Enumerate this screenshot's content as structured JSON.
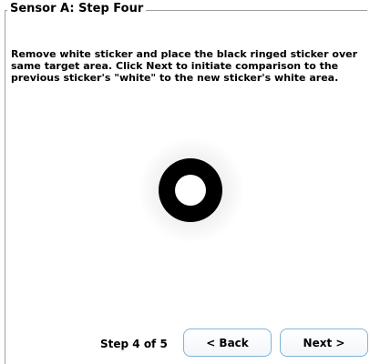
{
  "group": {
    "title": "Sensor A: Step Four"
  },
  "instructions": "Remove white sticker and place the black ringed sticker over same target area.  Click Next to initiate comparison to the previous sticker's \"white\" to the new sticker's white area.",
  "graphic": {
    "icon": "black-ringed-sticker-icon",
    "ring_color": "#000000",
    "center_color": "#ffffff"
  },
  "footer": {
    "step_label": "Step 4 of 5",
    "back_label": "< Back",
    "next_label": "Next >"
  },
  "colors": {
    "button_border": "#7fb4d9",
    "group_border": "#a0a0a0"
  }
}
